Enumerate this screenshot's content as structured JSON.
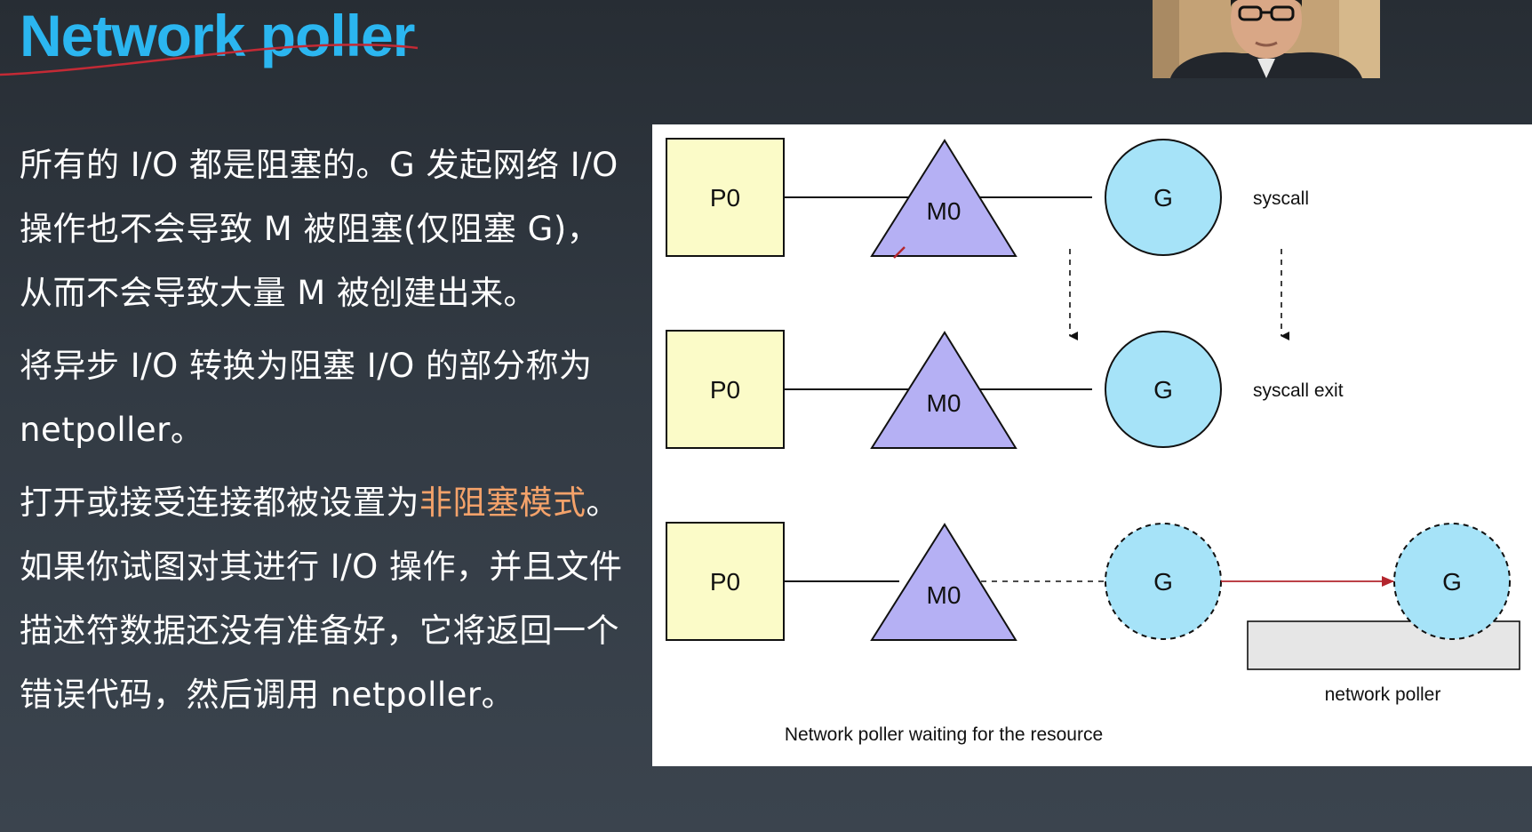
{
  "slide": {
    "title": "Network poller",
    "paragraphs": [
      {
        "text": "所有的 I/O 都是阻塞的。G 发起网络 I/O 操作也不会导致 M 被阻塞(仅阻塞 G)，从而不会导致大量 M 被创建出来。"
      },
      {
        "text": "将异步 I/O 转换为阻塞 I/O 的部分称为 netpoller。"
      },
      {
        "before": "打开或接受连接都被设置为",
        "highlight": "非阻塞模式",
        "after": "。如果你试图对其进行 I/O 操作，并且文件描述符数据还没有准备好，它将返回一个错误代码，然后调用 netpoller。"
      }
    ]
  },
  "diagram": {
    "rows": [
      {
        "p": "P0",
        "m": "M0",
        "g": "G",
        "side": "syscall"
      },
      {
        "p": "P0",
        "m": "M0",
        "g": "G",
        "side": "syscall exit"
      },
      {
        "p": "P0",
        "m": "M0",
        "g": "G",
        "g2": "G",
        "poller": "network poller",
        "caption": "Network poller waiting for the resource"
      }
    ],
    "colors": {
      "p_fill": "#fbfbc8",
      "m_fill": "#b5b0f4",
      "g_fill": "#a6e3f8",
      "arrow_red": "#b3262e",
      "poller_fill": "#e6e6e6"
    }
  }
}
